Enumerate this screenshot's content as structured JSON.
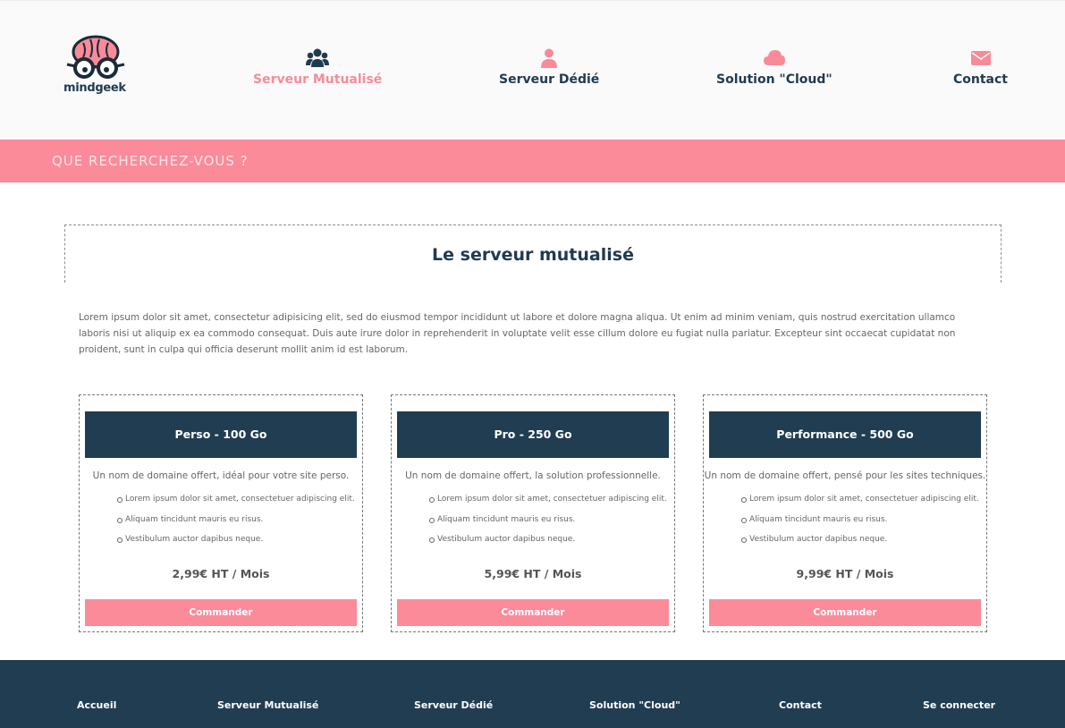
{
  "brand": {
    "name": "mindgeek",
    "accent": "#fb8b99",
    "dark": "#213d51"
  },
  "nav": [
    {
      "label": "Serveur Mutualisé",
      "icon": "users-icon",
      "active": true
    },
    {
      "label": "Serveur Dédié",
      "icon": "user-icon",
      "active": false
    },
    {
      "label": "Solution \"Cloud\"",
      "icon": "cloud-icon",
      "active": false
    },
    {
      "label": "Contact",
      "icon": "envelope-icon",
      "active": false
    }
  ],
  "search": {
    "placeholder": "QUE RECHERCHEZ-VOUS ?"
  },
  "main": {
    "title": "Le serveur mutualisé",
    "intro": "Lorem ipsum dolor sit amet, consectetur adipisicing elit, sed do eiusmod tempor incididunt ut labore et dolore magna aliqua. Ut enim ad minim veniam, quis nostrud exercitation ullamco laboris nisi ut aliquip ex ea commodo consequat. Duis aute irure dolor in reprehenderit in voluptate velit esse cillum dolore eu fugiat nulla pariatur. Excepteur sint occaecat cupidatat non proident, sunt in culpa qui officia deserunt mollit anim id est laborum."
  },
  "offers": [
    {
      "name": "Perso - 100 Go",
      "subtitle": "Un nom de domaine offert, idéal pour votre site perso.",
      "features": [
        "Lorem ipsum dolor sit amet, consectetuer adipiscing elit.",
        "Aliquam tincidunt mauris eu risus.",
        "Vestibulum auctor dapibus neque."
      ],
      "price": "2,99€ HT / Mois",
      "cta": "Commander"
    },
    {
      "name": "Pro - 250 Go",
      "subtitle": "Un nom de domaine offert, la solution professionnelle.",
      "features": [
        "Lorem ipsum dolor sit amet, consectetuer adipiscing elit.",
        "Aliquam tincidunt mauris eu risus.",
        "Vestibulum auctor dapibus neque."
      ],
      "price": "5,99€ HT / Mois",
      "cta": "Commander"
    },
    {
      "name": "Performance - 500 Go",
      "subtitle": "Un nom de domaine offert, pensé pour les sites techniques.",
      "features": [
        "Lorem ipsum dolor sit amet, consectetuer adipiscing elit.",
        "Aliquam tincidunt mauris eu risus.",
        "Vestibulum auctor dapibus neque."
      ],
      "price": "9,99€ HT / Mois",
      "cta": "Commander"
    }
  ],
  "footer": {
    "links": [
      "Accueil",
      "Serveur Mutualisé",
      "Serveur Dédié",
      "Solution \"Cloud\"",
      "Contact",
      "Se connecter"
    ]
  }
}
